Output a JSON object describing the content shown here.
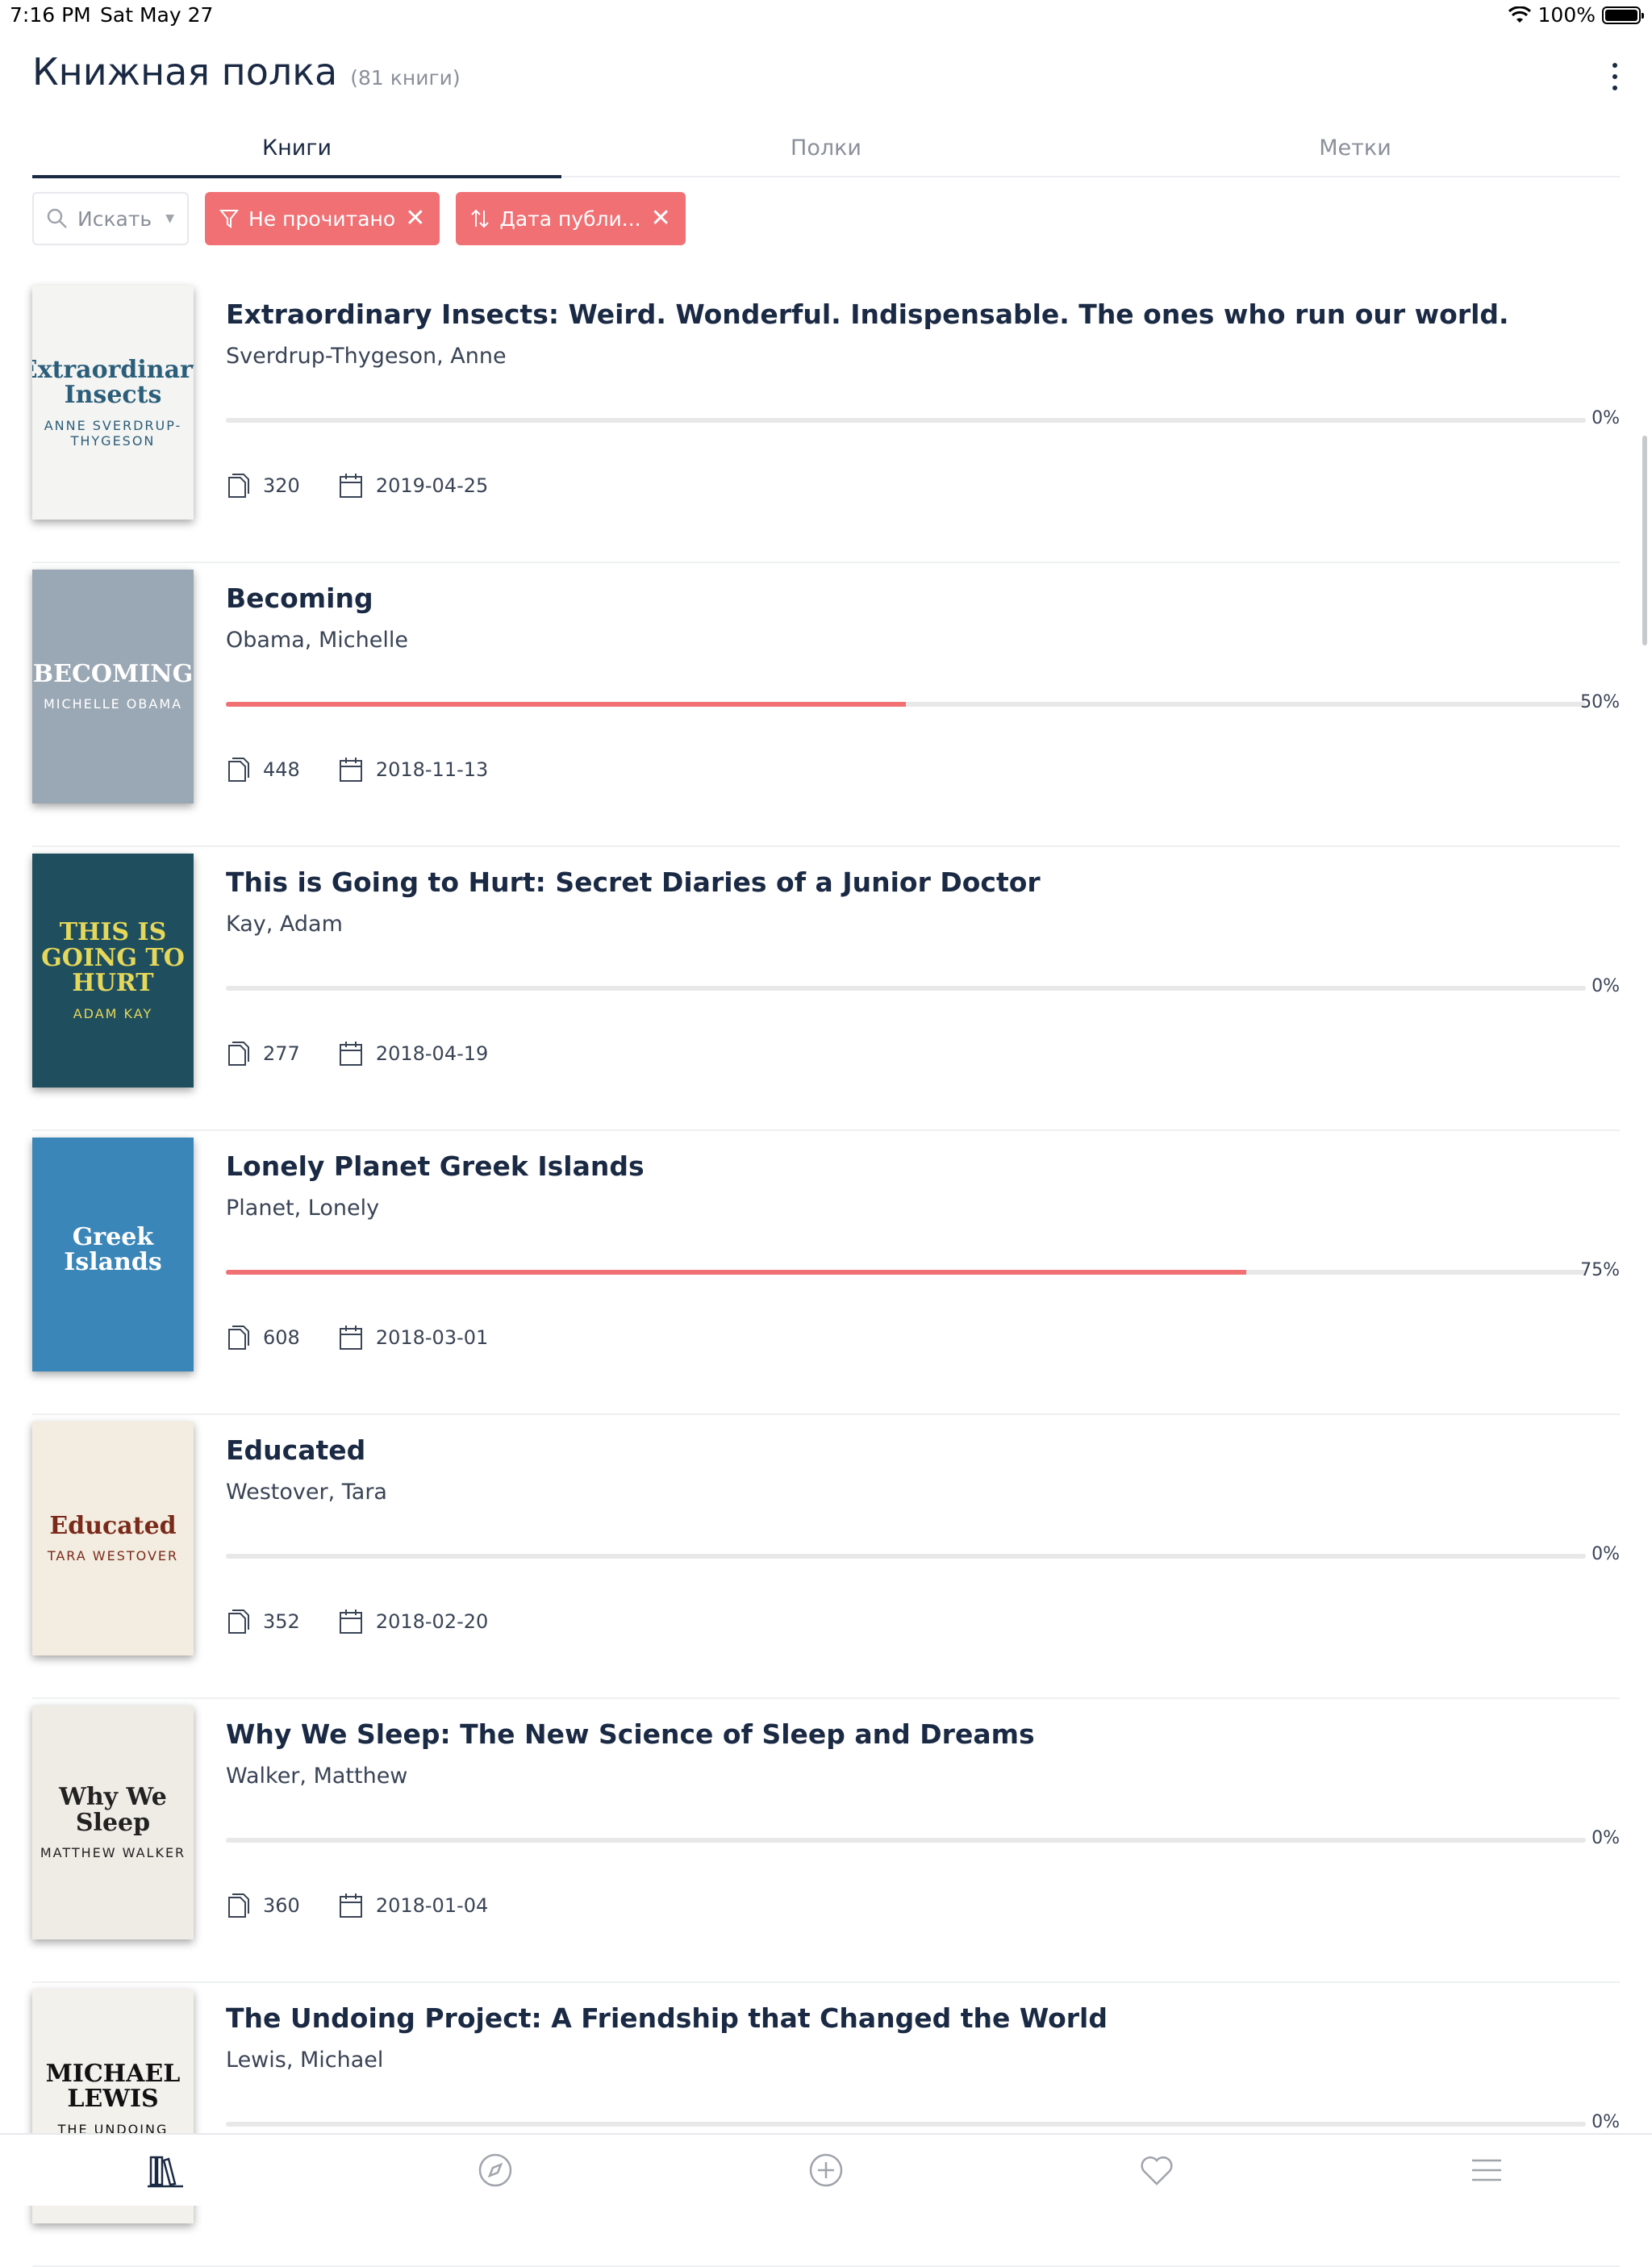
{
  "status": {
    "time": "7:16 PM",
    "date": "Sat May 27",
    "battery": "100%"
  },
  "header": {
    "title": "Книжная полка",
    "count": "(81 книги)"
  },
  "tabs": [
    {
      "label": "Книги"
    },
    {
      "label": "Полки"
    },
    {
      "label": "Метки"
    }
  ],
  "filters": {
    "search_label": "Искать",
    "chip_unread": "Не прочитано",
    "chip_sort": "Дата публи..."
  },
  "books": [
    {
      "title": "Extraordinary Insects: Weird. Wonderful. Indispensable. The ones who run our world.",
      "author": "Sverdrup-Thygeson, Anne",
      "progress": 0,
      "progress_label": "0%",
      "pages": "320",
      "date": "2019-04-25"
    },
    {
      "title": "Becoming",
      "author": "Obama, Michelle",
      "progress": 50,
      "progress_label": "50%",
      "pages": "448",
      "date": "2018-11-13"
    },
    {
      "title": "This is Going to Hurt: Secret Diaries of a Junior Doctor",
      "author": "Kay, Adam",
      "progress": 0,
      "progress_label": "0%",
      "pages": "277",
      "date": "2018-04-19"
    },
    {
      "title": "Lonely Planet Greek Islands",
      "author": "Planet, Lonely",
      "progress": 75,
      "progress_label": "75%",
      "pages": "608",
      "date": "2018-03-01"
    },
    {
      "title": "Educated",
      "author": "Westover, Tara",
      "progress": 0,
      "progress_label": "0%",
      "pages": "352",
      "date": "2018-02-20"
    },
    {
      "title": "Why We Sleep: The New Science of Sleep and Dreams",
      "author": "Walker, Matthew",
      "progress": 0,
      "progress_label": "0%",
      "pages": "360",
      "date": "2018-01-04"
    },
    {
      "title": "The Undoing Project: A Friendship that Changed the World",
      "author": "Lewis, Michael",
      "progress": 0,
      "progress_label": "0%",
      "pages": "",
      "date": ""
    }
  ],
  "covers": [
    {
      "text": "Extraordinary Insects",
      "sub": "ANNE SVERDRUP-THYGESON",
      "bg": "#f4f4f2",
      "fg": "#2b5e7a"
    },
    {
      "text": "BECOMING",
      "sub": "MICHELLE OBAMA",
      "bg": "#9aa7b4",
      "fg": "#ffffff"
    },
    {
      "text": "THIS IS GOING TO HURT",
      "sub": "ADAM KAY",
      "bg": "#1f4f5f",
      "fg": "#e5d75a"
    },
    {
      "text": "Greek Islands",
      "sub": "",
      "bg": "#3b86b8",
      "fg": "#ffffff"
    },
    {
      "text": "Educated",
      "sub": "TARA WESTOVER",
      "bg": "#f3ece0",
      "fg": "#7a2a1a"
    },
    {
      "text": "Why We Sleep",
      "sub": "MATTHEW WALKER",
      "bg": "#efece6",
      "fg": "#222222"
    },
    {
      "text": "MICHAEL LEWIS",
      "sub": "THE UNDOING PROJECT",
      "bg": "#f3f1ec",
      "fg": "#111111"
    }
  ],
  "colors": {
    "accent": "#f07074",
    "text": "#1b2a44",
    "muted": "#8a8f99"
  },
  "tabbar_icons": [
    "library-icon",
    "compass-icon",
    "add-icon",
    "heart-icon",
    "menu-icon"
  ]
}
